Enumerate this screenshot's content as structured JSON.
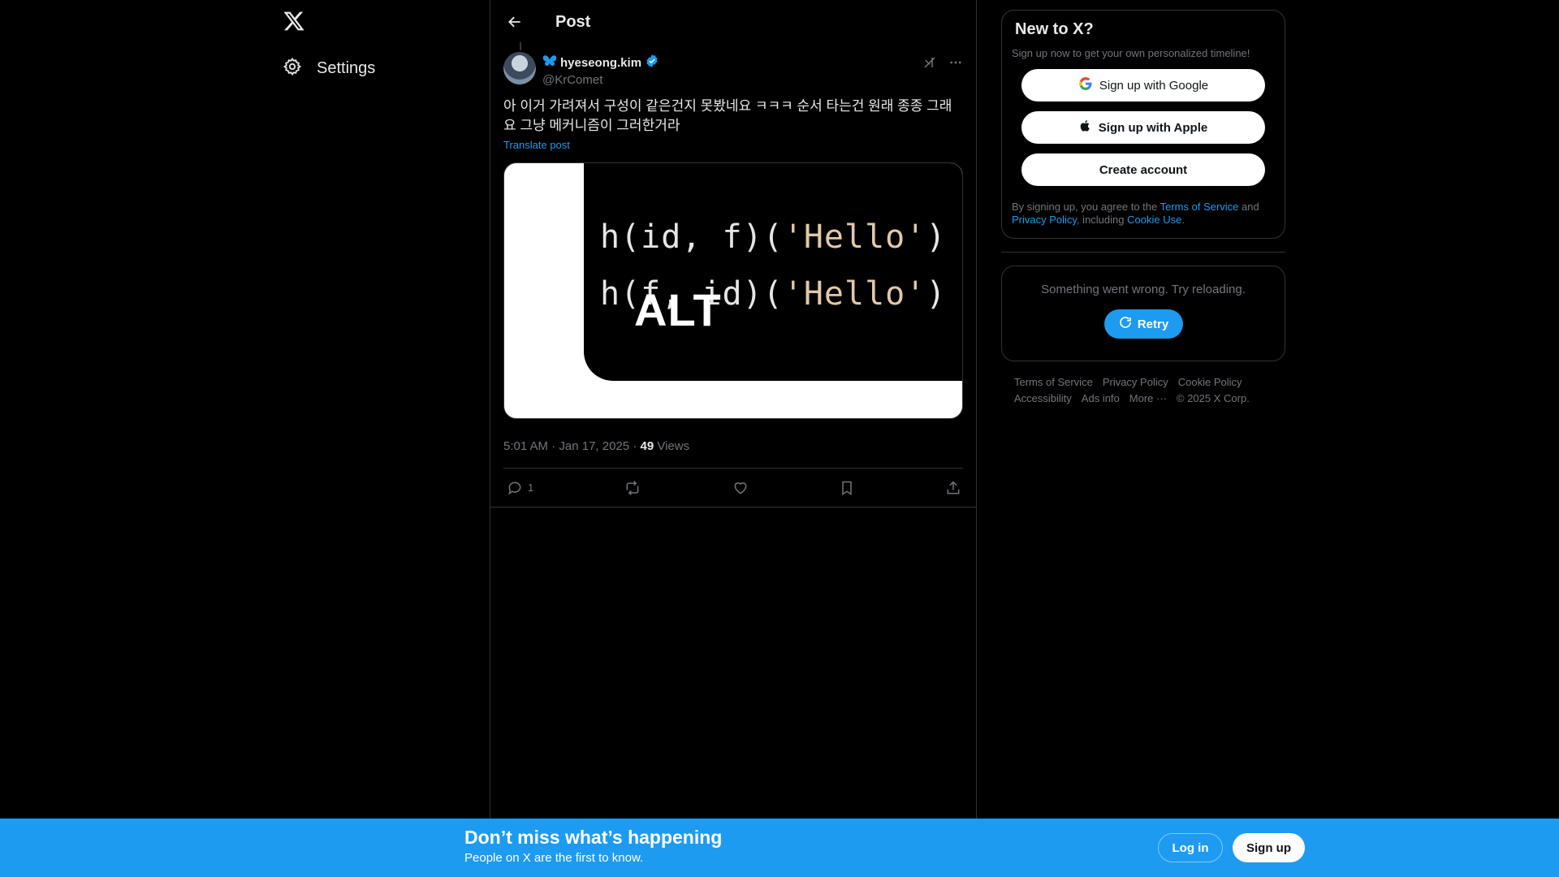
{
  "nav": {
    "logo_icon": "x-logo-icon",
    "settings_label": "Settings"
  },
  "header": {
    "title": "Post"
  },
  "post": {
    "author_name": "hyeseong.kim",
    "author_handle": "@KrComet",
    "text": "아 이거 가려져서 구성이 같은건지 못봤네요 ㅋㅋㅋ 순서 타는건 원래 종종 그래요 그냥 메커니즘이 그러한거라",
    "translate_label": "Translate post",
    "media": {
      "code_line_1_prefix": "h(id, f)(",
      "code_line_1_string": "'Hello'",
      "code_line_1_suffix": ") //",
      "code_line_2_prefix": "h(f, id)(",
      "code_line_2_string": "'Hello'",
      "code_line_2_suffix": ") //",
      "alt_badge": "ALT"
    },
    "time": "5:01 AM",
    "date": "Jan 17, 2025",
    "views_count": "49",
    "views_label": "Views",
    "reply_count": "1"
  },
  "signup_card": {
    "title": "New to X?",
    "subtitle": "Sign up now to get your own personalized timeline!",
    "google_label": "Sign up with Google",
    "apple_label": "Sign up with Apple",
    "create_label": "Create account",
    "legal_prefix": "By signing up, you agree to the ",
    "terms_link": "Terms of Service",
    "legal_and": " and ",
    "privacy_link": "Privacy Policy",
    "legal_including": ", including ",
    "cookie_link": "Cookie Use",
    "legal_end": "."
  },
  "error_card": {
    "message": "Something went wrong. Try reloading.",
    "retry_label": "Retry"
  },
  "footer": {
    "links": [
      "Terms of Service",
      "Privacy Policy",
      "Cookie Policy",
      "Accessibility",
      "Ads info",
      "More ···",
      "© 2025 X Corp."
    ]
  },
  "banner": {
    "headline": "Don’t miss what’s happening",
    "subline": "People on X are the first to know.",
    "login_label": "Log in",
    "signup_label": "Sign up"
  },
  "colors": {
    "accent": "#1d9bf0",
    "background": "#000000",
    "border": "#2f3336",
    "muted_text": "#71767b"
  }
}
